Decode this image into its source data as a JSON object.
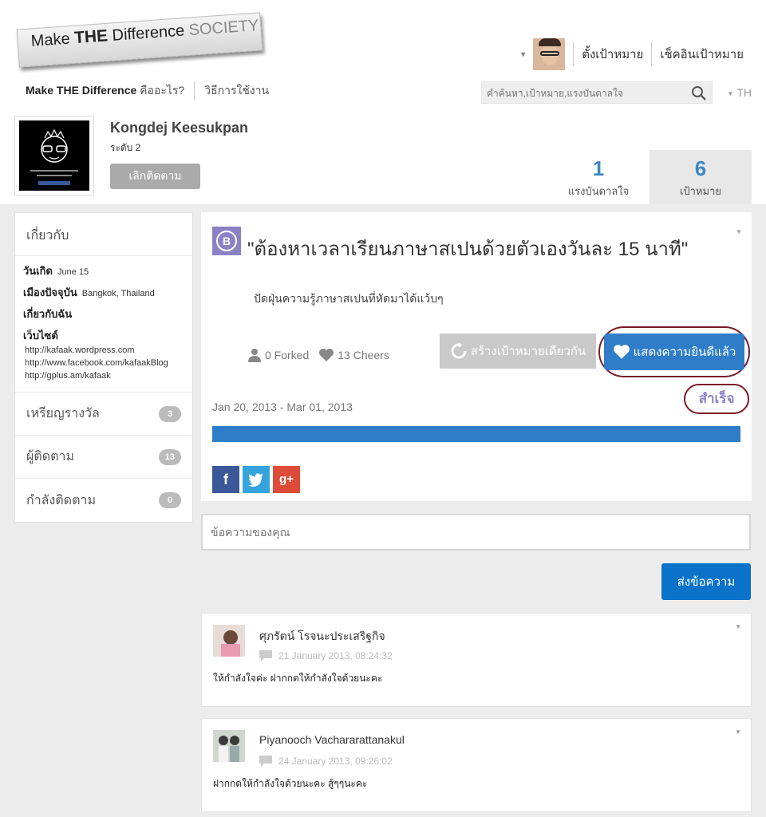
{
  "logo": {
    "make": "Make ",
    "the": "THE",
    "difference": " Difference ",
    "society": "SOCIETY"
  },
  "topnav": {
    "brand_bold": "Make THE Difference",
    "brand_q": " คืออะไร?",
    "howto": "วิธีการใช้งาน"
  },
  "usermenu": {
    "set_goal": "ตั้งเป้าหมาย",
    "checkin_goal": "เช็คอินเป้าหมาย"
  },
  "search": {
    "placeholder": "คำค้นหา,เป้าหมาย,แรงบันดาลใจ"
  },
  "lang": "TH",
  "profile": {
    "name": "Kongdej Keesukpan",
    "level": "ระดับ 2",
    "unfollow": "เลิกติดตาม",
    "stats": [
      {
        "value": "1",
        "label": "แรงบันดาลใจ"
      },
      {
        "value": "6",
        "label": "เป้าหมาย"
      }
    ]
  },
  "sidebar": {
    "heading": "เกี่ยวกับ",
    "birthday_label": "วันเกิด",
    "birthday_value": "June 15",
    "city_label": "เมืองปัจจุบัน",
    "city_value": "Bangkok, Thailand",
    "about_me_label": "เกี่ยวกับฉัน",
    "website_label": "เว็บไซต์",
    "links": [
      "http://kafaak.wordpress.com",
      "http://www.facebook.com/kafaakBlog",
      "http://gplus.am/kafaak"
    ],
    "items": [
      {
        "label": "เหรียญรางวัล",
        "count": "3"
      },
      {
        "label": "ผู้ติดตาม",
        "count": "13"
      },
      {
        "label": "กำลังติดตาม",
        "count": "0"
      }
    ]
  },
  "goal": {
    "icon_letter": "B",
    "title": "\"ต้องหาเวลาเรียนภาษาสเปนด้วยตัวเองวันละ 15 นาที\"",
    "description": "ปัดฝุ่นความรู้ภาษาสเปนที่หัดมาได้แว้บๆ",
    "forked": "0 Forked",
    "cheers": "13 Cheers",
    "fork_button": "สร้างเป้าหมายเดียวกัน",
    "cheer_button": "แสดงความยินดีแล้ว",
    "date_range": "Jan 20, 2013 - Mar 01, 2013",
    "status": "สำเร็จ",
    "progress_percent": 100
  },
  "share": {
    "facebook": "f",
    "twitter": "t",
    "googleplus": "g+"
  },
  "message": {
    "placeholder": "ข้อความของคุณ",
    "send": "ส่งข้อความ"
  },
  "comments": [
    {
      "name": "ศุภรัตน์ โรจนะประเสริฐกิจ",
      "time": "21 January 2013, 08:24:32",
      "text": "ให้กำลังใจค่ะ ฝากกดให้กำลังใจด้วยนะคะ"
    },
    {
      "name": "Piyanooch Vachararattanakul",
      "time": "24 January 2013, 09:26:02",
      "text": "ฝากกดให้กำลังใจด้วยนะคะ สู้ๆๆนะคะ"
    }
  ],
  "colors": {
    "accent": "#2f7dc8",
    "goal_icon": "#8a82c4",
    "highlight_ring": "#7a1b26"
  }
}
